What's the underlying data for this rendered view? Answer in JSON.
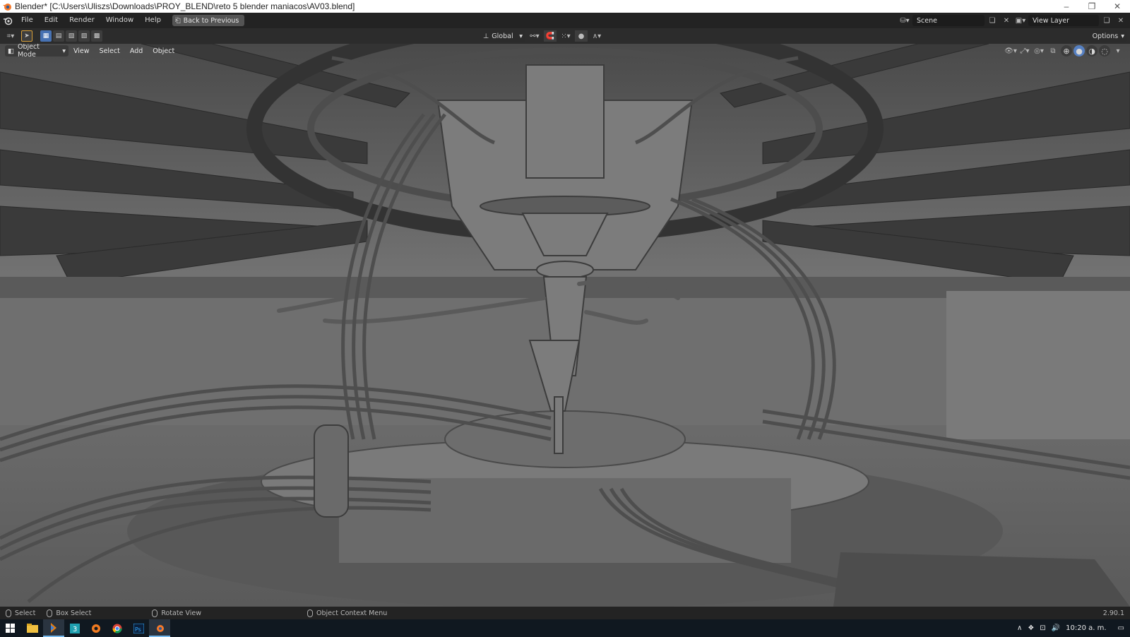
{
  "window": {
    "title": "Blender* [C:\\Users\\Uliszs\\Downloads\\PROY_BLEND\\reto 5 blender maniacos\\AV03.blend]",
    "minimize_glyph": "–",
    "restore_glyph": "❐",
    "close_glyph": "✕"
  },
  "topbar": {
    "menus": [
      "File",
      "Edit",
      "Render",
      "Window",
      "Help"
    ],
    "back_label": "Back to Previous",
    "scene_value": "Scene",
    "view_layer_value": "View Layer"
  },
  "toolbar": {
    "orientation": "Global",
    "options_label": "Options"
  },
  "viewport": {
    "mode": "Object Mode",
    "menus": [
      "View",
      "Select",
      "Add",
      "Object"
    ]
  },
  "statusbar": {
    "select": "Select",
    "box_select": "Box Select",
    "rotate_view": "Rotate View",
    "context_menu": "Object Context Menu",
    "version": "2.90.1"
  },
  "taskbar": {
    "clock": "10:20 a. m.",
    "apps": [
      "start-icon",
      "file-explorer-icon",
      "blender-launcher-icon",
      "app-3-icon",
      "settings-icon",
      "chrome-icon",
      "photoshop-icon",
      "blender-icon"
    ]
  },
  "colors": {
    "accent": "#4772b3",
    "blender_orange": "#f5792a",
    "viewport_gray": "#6e6e6e"
  }
}
